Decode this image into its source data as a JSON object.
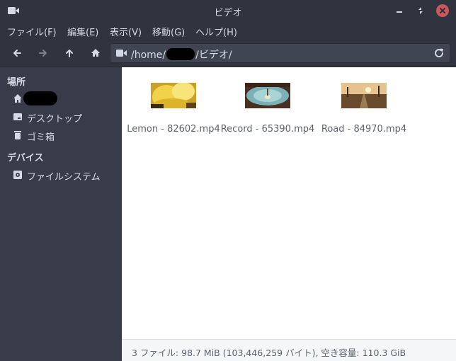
{
  "window": {
    "title": "ビデオ"
  },
  "menu": [
    "ファイル(F)",
    "編集(E)",
    "表示(V)",
    "移動(G)",
    "ヘルプ(H)"
  ],
  "path": {
    "prefix": "/home/",
    "suffix": "/ビデオ/"
  },
  "sidebar": {
    "places_heading": "場所",
    "places": [
      {
        "label": "",
        "icon": "home-icon"
      },
      {
        "label": "デスクトップ",
        "icon": "desktop-icon"
      },
      {
        "label": "ゴミ箱",
        "icon": "trash-icon"
      }
    ],
    "devices_heading": "デバイス",
    "devices": [
      {
        "label": "ファイルシステム",
        "icon": "drive-icon"
      }
    ]
  },
  "files": [
    {
      "name": "Lemon - 82602.mp4"
    },
    {
      "name": "Record - 65390.mp4"
    },
    {
      "name": "Road - 84970.mp4"
    }
  ],
  "status": "3 ファイル: 98.7 MiB (103,446,259 バイト), 空き容量: 110.3 GiB",
  "colors": {
    "window_bg": "#2f343f",
    "sidebar_bg": "#383c4a",
    "content_bg": "#ffffff",
    "close_button": "#cc575d",
    "text_light": "#d3dae3",
    "text_dark": "#5c616c"
  }
}
